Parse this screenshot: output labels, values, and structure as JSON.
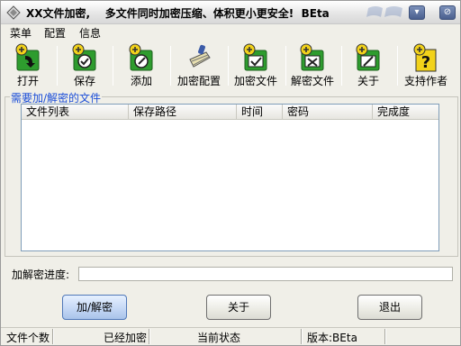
{
  "window": {
    "title": "XX文件加密,    多文件同时加密压缩、体积更小更安全!  BEta",
    "minimize_glyph": "▾",
    "close_glyph": "⊘"
  },
  "menu": {
    "items": [
      {
        "label": "菜单"
      },
      {
        "label": "配置"
      },
      {
        "label": "信息"
      }
    ]
  },
  "toolbar": {
    "items": [
      {
        "label": "打开",
        "icon": "open-icon"
      },
      {
        "label": "保存",
        "icon": "save-icon"
      },
      {
        "label": "添加",
        "icon": "add-icon"
      },
      {
        "label": "加密配置",
        "icon": "brush-icon"
      },
      {
        "label": "加密文件",
        "icon": "encrypt-icon"
      },
      {
        "label": "解密文件",
        "icon": "decrypt-icon"
      },
      {
        "label": "关于",
        "icon": "about-icon"
      },
      {
        "label": "支持作者",
        "icon": "help-icon"
      }
    ]
  },
  "file_group": {
    "title": "需要加/解密的文件",
    "columns": [
      "文件列表",
      "保存路径",
      "时间",
      "密码",
      "完成度"
    ],
    "rows": []
  },
  "progress": {
    "label": "加解密进度:",
    "value": 0
  },
  "buttons": {
    "encrypt_decrypt": "加/解密",
    "about": "关于",
    "exit": "退出"
  },
  "status": {
    "file_count_label": "文件个数",
    "encrypted_label": "已经加密",
    "current_state_label": "当前状态",
    "version_label": "版本:BEta"
  },
  "colors": {
    "group_title": "#1a4dd8",
    "icon_green": "#2e9c2e",
    "icon_yellow": "#f2d21a",
    "window_bg": "#f0efe8"
  }
}
